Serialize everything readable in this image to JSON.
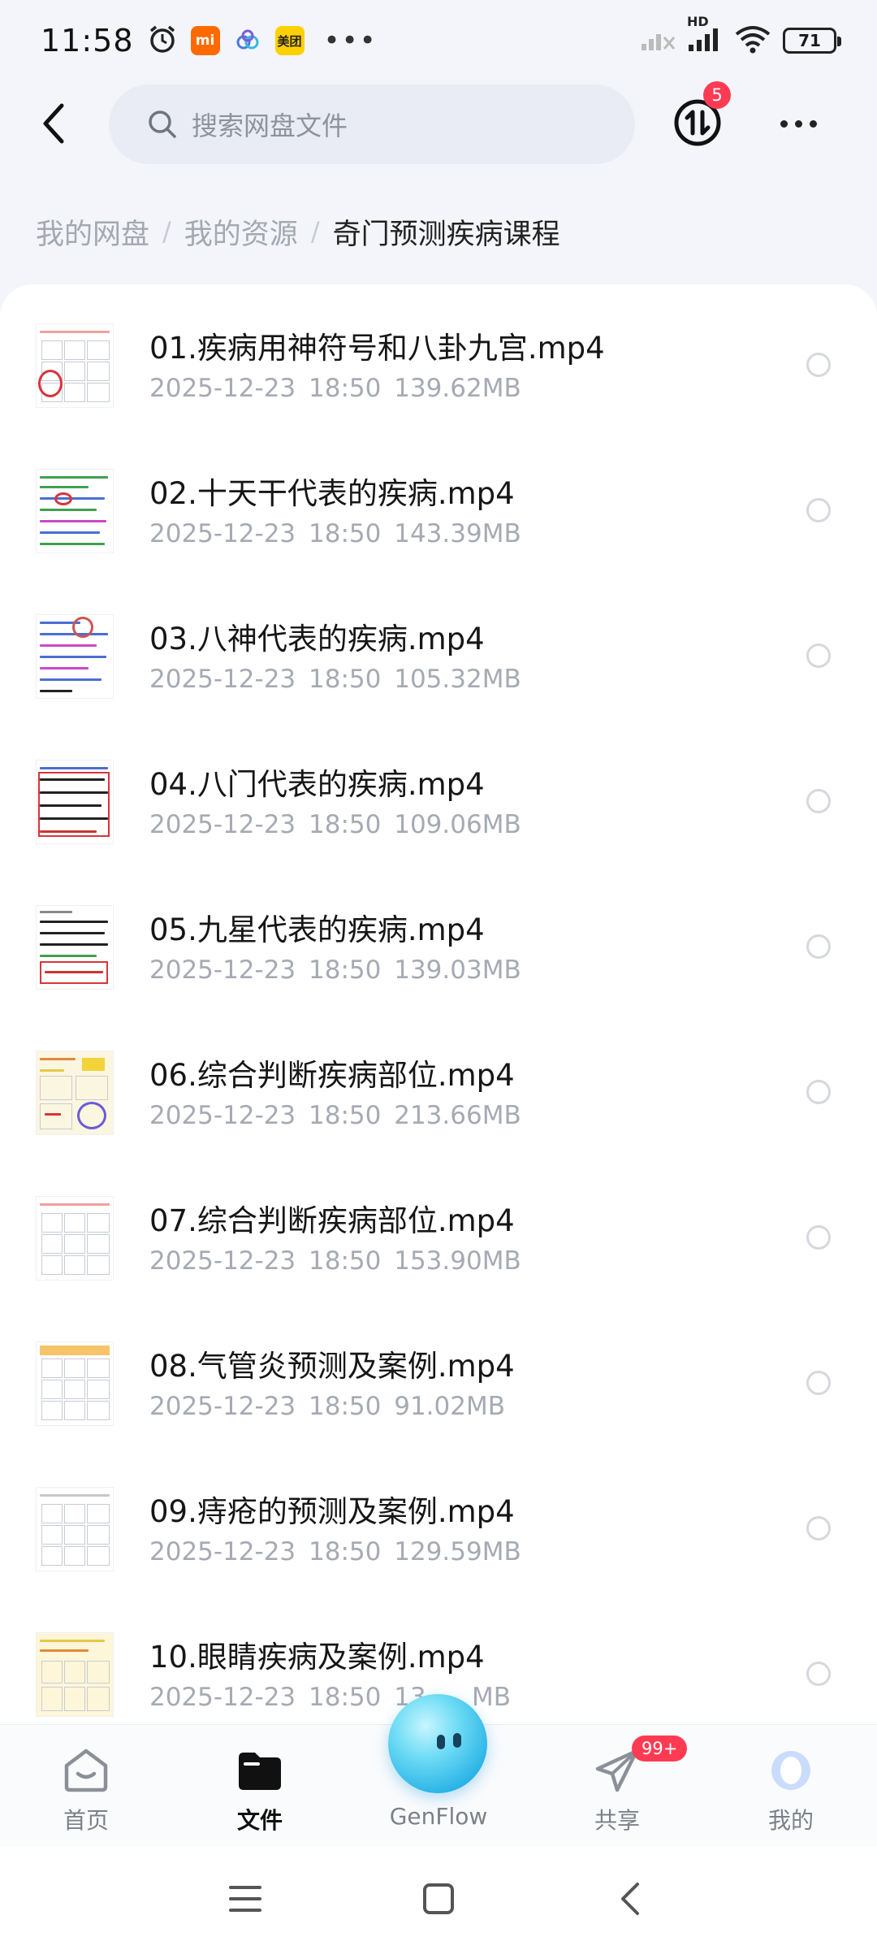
{
  "status_bar": {
    "time": "11:58",
    "icons": [
      "alarm-icon",
      "mi-app-icon",
      "cloud-app-icon",
      "meituan-app-icon",
      "more-notifications-icon"
    ],
    "mi_label": "mi",
    "meituan_label": "美团",
    "dots": "•••",
    "network_label": "HD",
    "battery": "71"
  },
  "header": {
    "search_placeholder": "搜索网盘文件",
    "transfer_badge": "5"
  },
  "breadcrumb": {
    "items": [
      "我的网盘",
      "我的资源",
      "奇门预测疾病课程"
    ],
    "separator": "/"
  },
  "files": [
    {
      "name": "01.疾病用神符号和八卦九宫.mp4",
      "date": "2025-12-23",
      "time": "18:50",
      "size": "139.62MB"
    },
    {
      "name": "02.十天干代表的疾病.mp4",
      "date": "2025-12-23",
      "time": "18:50",
      "size": "143.39MB"
    },
    {
      "name": "03.八神代表的疾病.mp4",
      "date": "2025-12-23",
      "time": "18:50",
      "size": "105.32MB"
    },
    {
      "name": "04.八门代表的疾病.mp4",
      "date": "2025-12-23",
      "time": "18:50",
      "size": "109.06MB"
    },
    {
      "name": "05.九星代表的疾病.mp4",
      "date": "2025-12-23",
      "time": "18:50",
      "size": "139.03MB"
    },
    {
      "name": "06.综合判断疾病部位.mp4",
      "date": "2025-12-23",
      "time": "18:50",
      "size": "213.66MB"
    },
    {
      "name": "07.综合判断疾病部位.mp4",
      "date": "2025-12-23",
      "time": "18:50",
      "size": "153.90MB"
    },
    {
      "name": "08.气管炎预测及案例.mp4",
      "date": "2025-12-23",
      "time": "18:50",
      "size": "91.02MB"
    },
    {
      "name": "09.痔疮的预测及案例.mp4",
      "date": "2025-12-23",
      "time": "18:50",
      "size": "129.59MB"
    },
    {
      "name": "10.眼睛疾病及案例.mp4",
      "date": "2025-12-23",
      "time": "18:50",
      "size": "13_.__MB"
    }
  ],
  "tabs": [
    {
      "label": "首页",
      "icon": "home-icon",
      "active": false
    },
    {
      "label": "文件",
      "icon": "folder-icon",
      "active": true
    },
    {
      "label": "GenFlow",
      "icon": "genflow-orb-icon",
      "active": false
    },
    {
      "label": "共享",
      "icon": "share-plane-icon",
      "active": false,
      "badge": "99+"
    },
    {
      "label": "我的",
      "icon": "profile-icon",
      "active": false
    }
  ],
  "colors": {
    "accent_badge": "#ff3b54",
    "active_tab": "#111111",
    "muted_text": "#a5aab3"
  }
}
